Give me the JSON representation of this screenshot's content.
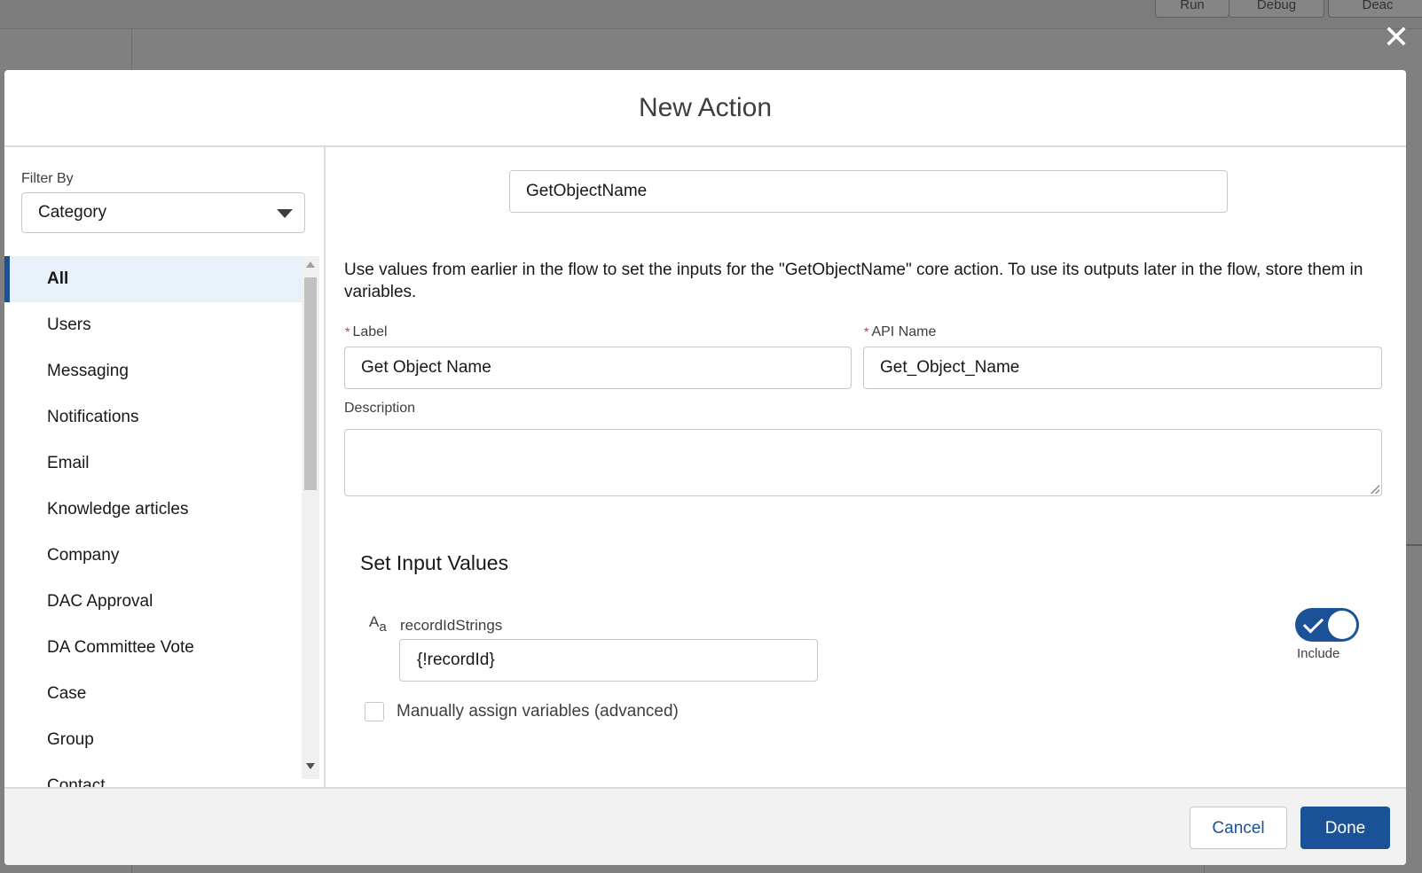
{
  "background": {
    "buttons": [
      "Run",
      "Debug",
      "Deac"
    ]
  },
  "modal": {
    "title": "New Action",
    "close_icon": "close-icon"
  },
  "filter": {
    "label": "Filter By",
    "selected": "Category"
  },
  "categories": [
    {
      "label": "All",
      "active": true
    },
    {
      "label": "Users"
    },
    {
      "label": "Messaging"
    },
    {
      "label": "Notifications"
    },
    {
      "label": "Email"
    },
    {
      "label": "Knowledge articles"
    },
    {
      "label": "Company"
    },
    {
      "label": "DAC Approval"
    },
    {
      "label": "DA Committee Vote"
    },
    {
      "label": "Case"
    },
    {
      "label": "Group"
    },
    {
      "label": "Contact"
    }
  ],
  "action": {
    "search_value": "GetObjectName",
    "help_text": "Use values from earlier in the flow to set the inputs for the \"GetObjectName\" core action. To use its outputs later in the flow, store them in variables.",
    "label_field": {
      "label": "Label",
      "required_mark": "*",
      "value": "Get Object Name"
    },
    "api_field": {
      "label": "API Name",
      "required_mark": "*",
      "value": "Get_Object_Name"
    },
    "description_field": {
      "label": "Description",
      "value": ""
    }
  },
  "inputs": {
    "section_title": "Set Input Values",
    "type_icon_big": "A",
    "type_icon_small": "a",
    "param_name": "recordIdStrings",
    "param_value": "{!recordId}",
    "toggle_label": "Include",
    "toggle_on": true,
    "manual_assign_label": "Manually assign variables (advanced)",
    "manual_assign_checked": false
  },
  "footer": {
    "cancel_label": "Cancel",
    "done_label": "Done"
  },
  "colors": {
    "brand": "#1b5297",
    "active_bg": "#e8f0fa",
    "required": "#c23934"
  }
}
